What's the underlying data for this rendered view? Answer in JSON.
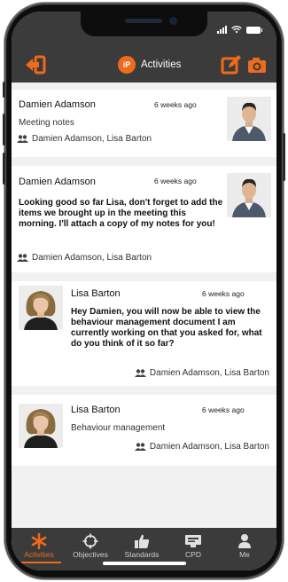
{
  "app": {
    "title": "Activities",
    "logo_text": "iP",
    "accent_color": "#ef6b1c",
    "bar_color": "#3b3b3b"
  },
  "header": {
    "back_icon": "exit-arrow-icon",
    "edit_icon": "edit-note-icon",
    "camera_icon": "camera-icon"
  },
  "feed": {
    "items": [
      {
        "author": "Damien Adamson",
        "time": "6 weeks ago",
        "text": "Meeting notes",
        "members": "Damien Adamson, Lisa Barton",
        "avatar": "man-avatar"
      },
      {
        "author": "Damien Adamson",
        "time": "6 weeks ago",
        "text": "Looking good so far Lisa, don't forget to add the items we brought up in the meeting this morning. I'll attach a copy of my notes for you!",
        "members": "Damien Adamson, Lisa Barton",
        "avatar": "man-avatar"
      },
      {
        "author": "Lisa Barton",
        "time": "6 weeks ago",
        "text": "Hey Damien, you will now be able to view the behaviour management document I am currently working on that you asked for, what do you think of it so far?",
        "members": "Damien Adamson, Lisa Barton",
        "avatar": "woman-avatar"
      },
      {
        "author": "Lisa Barton",
        "time": "6 weeks ago",
        "text": "Behaviour management",
        "members": "Damien Adamson, Lisa Barton",
        "avatar": "woman-avatar"
      }
    ]
  },
  "tabs": [
    {
      "label": "Activities",
      "icon": "asterisk-icon",
      "active": true
    },
    {
      "label": "Objectives",
      "icon": "target-icon",
      "active": false
    },
    {
      "label": "Standards",
      "icon": "thumbs-up-icon",
      "active": false
    },
    {
      "label": "CPD",
      "icon": "certificate-icon",
      "active": false
    },
    {
      "label": "Me",
      "icon": "person-icon",
      "active": false
    }
  ]
}
